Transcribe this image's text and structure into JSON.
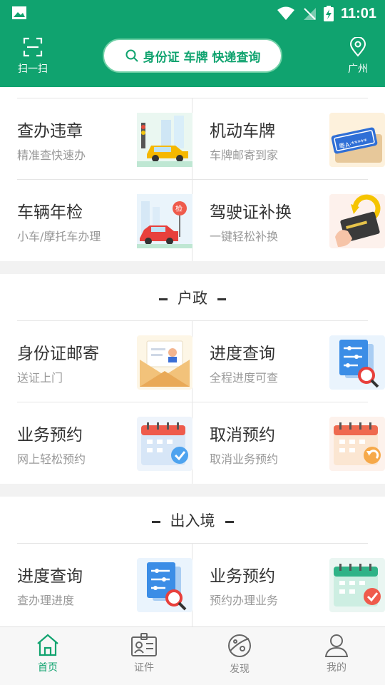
{
  "status_bar": {
    "time": "11:01"
  },
  "header": {
    "scan_label": "扫一扫",
    "search_text": "身份证 车牌 快递查询",
    "location_label": "广州"
  },
  "sections": [
    {
      "title": "",
      "items": [
        {
          "name": "查办违章",
          "sub": "精准查快速办",
          "icon": "traffic-violation-car-icon"
        },
        {
          "name": "机动车牌",
          "sub": "车牌邮寄到家",
          "icon": "license-plate-icon"
        },
        {
          "name": "车辆年检",
          "sub": "小车/摩托车办理",
          "icon": "vehicle-inspection-icon"
        },
        {
          "name": "驾驶证补换",
          "sub": "一键轻松补换",
          "icon": "driver-license-renew-icon"
        }
      ]
    },
    {
      "title": "户政",
      "items": [
        {
          "name": "身份证邮寄",
          "sub": "送证上门",
          "icon": "id-card-envelope-icon"
        },
        {
          "name": "进度查询",
          "sub": "全程进度可查",
          "icon": "progress-search-document-icon"
        },
        {
          "name": "业务预约",
          "sub": "网上轻松预约",
          "icon": "calendar-check-icon"
        },
        {
          "name": "取消预约",
          "sub": "取消业务预约",
          "icon": "calendar-cancel-icon"
        }
      ]
    },
    {
      "title": "出入境",
      "items": [
        {
          "name": "进度查询",
          "sub": "查办理进度",
          "icon": "progress-search-document-icon"
        },
        {
          "name": "业务预约",
          "sub": "预约办理业务",
          "icon": "calendar-check-icon"
        }
      ]
    }
  ],
  "bottom_nav": {
    "items": [
      {
        "label": "首页",
        "icon": "home-icon",
        "active": true
      },
      {
        "label": "证件",
        "icon": "id-badge-icon",
        "active": false
      },
      {
        "label": "发现",
        "icon": "discover-planet-icon",
        "active": false
      },
      {
        "label": "我的",
        "icon": "user-icon",
        "active": false
      }
    ]
  },
  "colors": {
    "brand": "#10a36f",
    "text_primary": "#333333",
    "text_secondary": "#999999"
  }
}
